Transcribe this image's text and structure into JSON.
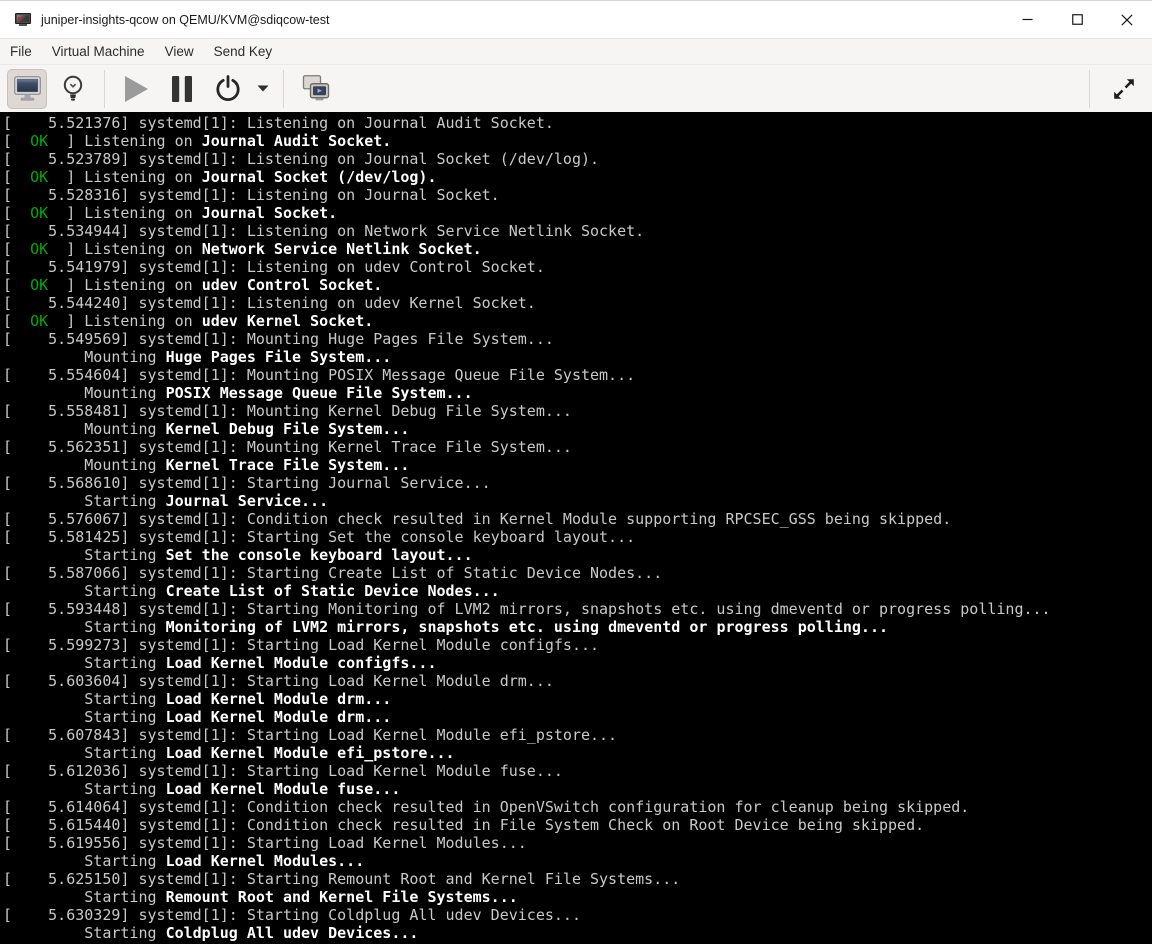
{
  "window": {
    "title": "juniper-insights-qcow on QEMU/KVM@sdiqcow-test",
    "controls": [
      "minimize",
      "maximize",
      "close"
    ]
  },
  "menu": {
    "items": [
      "File",
      "Virtual Machine",
      "View",
      "Send Key"
    ]
  },
  "toolbar": {
    "buttons": [
      "graphical-console",
      "virtual-hardware-details",
      "run",
      "pause",
      "shutdown",
      "shutdown-menu",
      "virtual-displays",
      "fullscreen"
    ],
    "active_button": "graphical-console",
    "disabled_button": "run"
  },
  "colors": {
    "console_bg": "#000000",
    "console_text": "#c9c9c9",
    "console_bold": "#ffffff",
    "ok_green": "#00ab00",
    "chrome_bg": "#f6f5f4",
    "titlebar_bg": "#ffffff"
  },
  "console": {
    "lines": [
      [
        {
          "s": "g",
          "t": "[    5.521376] systemd[1]: Listening on Journal Audit Socket."
        }
      ],
      [
        {
          "s": "g",
          "t": "[  "
        },
        {
          "s": "o",
          "t": "OK"
        },
        {
          "s": "g",
          "t": "  ] Listening on "
        },
        {
          "s": "w",
          "t": "Journal Audit Socket."
        }
      ],
      [
        {
          "s": "g",
          "t": "[    5.523789] systemd[1]: Listening on Journal Socket (/dev/log)."
        }
      ],
      [
        {
          "s": "g",
          "t": "[  "
        },
        {
          "s": "o",
          "t": "OK"
        },
        {
          "s": "g",
          "t": "  ] Listening on "
        },
        {
          "s": "w",
          "t": "Journal Socket (/dev/log)."
        }
      ],
      [
        {
          "s": "g",
          "t": "[    5.528316] systemd[1]: Listening on Journal Socket."
        }
      ],
      [
        {
          "s": "g",
          "t": "[  "
        },
        {
          "s": "o",
          "t": "OK"
        },
        {
          "s": "g",
          "t": "  ] Listening on "
        },
        {
          "s": "w",
          "t": "Journal Socket."
        }
      ],
      [
        {
          "s": "g",
          "t": "[    5.534944] systemd[1]: Listening on Network Service Netlink Socket."
        }
      ],
      [
        {
          "s": "g",
          "t": "[  "
        },
        {
          "s": "o",
          "t": "OK"
        },
        {
          "s": "g",
          "t": "  ] Listening on "
        },
        {
          "s": "w",
          "t": "Network Service Netlink Socket."
        }
      ],
      [
        {
          "s": "g",
          "t": "[    5.541979] systemd[1]: Listening on udev Control Socket."
        }
      ],
      [
        {
          "s": "g",
          "t": "[  "
        },
        {
          "s": "o",
          "t": "OK"
        },
        {
          "s": "g",
          "t": "  ] Listening on "
        },
        {
          "s": "w",
          "t": "udev Control Socket."
        }
      ],
      [
        {
          "s": "g",
          "t": "[    5.544240] systemd[1]: Listening on udev Kernel Socket."
        }
      ],
      [
        {
          "s": "g",
          "t": "[  "
        },
        {
          "s": "o",
          "t": "OK"
        },
        {
          "s": "g",
          "t": "  ] Listening on "
        },
        {
          "s": "w",
          "t": "udev Kernel Socket."
        }
      ],
      [
        {
          "s": "g",
          "t": "[    5.549569] systemd[1]: Mounting Huge Pages File System..."
        }
      ],
      [
        {
          "s": "g",
          "t": "         Mounting "
        },
        {
          "s": "w",
          "t": "Huge Pages File System..."
        }
      ],
      [
        {
          "s": "g",
          "t": "[    5.554604] systemd[1]: Mounting POSIX Message Queue File System..."
        }
      ],
      [
        {
          "s": "g",
          "t": "         Mounting "
        },
        {
          "s": "w",
          "t": "POSIX Message Queue File System..."
        }
      ],
      [
        {
          "s": "g",
          "t": "[    5.558481] systemd[1]: Mounting Kernel Debug File System..."
        }
      ],
      [
        {
          "s": "g",
          "t": "         Mounting "
        },
        {
          "s": "w",
          "t": "Kernel Debug File System..."
        }
      ],
      [
        {
          "s": "g",
          "t": "[    5.562351] systemd[1]: Mounting Kernel Trace File System..."
        }
      ],
      [
        {
          "s": "g",
          "t": "         Mounting "
        },
        {
          "s": "w",
          "t": "Kernel Trace File System..."
        }
      ],
      [
        {
          "s": "g",
          "t": "[    5.568610] systemd[1]: Starting Journal Service..."
        }
      ],
      [
        {
          "s": "g",
          "t": "         Starting "
        },
        {
          "s": "w",
          "t": "Journal Service..."
        }
      ],
      [
        {
          "s": "g",
          "t": "[    5.576067] systemd[1]: Condition check resulted in Kernel Module supporting RPCSEC_GSS being skipped."
        }
      ],
      [
        {
          "s": "g",
          "t": "[    5.581425] systemd[1]: Starting Set the console keyboard layout..."
        }
      ],
      [
        {
          "s": "g",
          "t": "         Starting "
        },
        {
          "s": "w",
          "t": "Set the console keyboard layout..."
        }
      ],
      [
        {
          "s": "g",
          "t": "[    5.587066] systemd[1]: Starting Create List of Static Device Nodes..."
        }
      ],
      [
        {
          "s": "g",
          "t": "         Starting "
        },
        {
          "s": "w",
          "t": "Create List of Static Device Nodes..."
        }
      ],
      [
        {
          "s": "g",
          "t": "[    5.593448] systemd[1]: Starting Monitoring of LVM2 mirrors, snapshots etc. using dmeventd or progress polling..."
        }
      ],
      [
        {
          "s": "g",
          "t": "         Starting "
        },
        {
          "s": "w",
          "t": "Monitoring of LVM2 mirrors, snapshots etc. using dmeventd or progress polling..."
        }
      ],
      [
        {
          "s": "g",
          "t": "[    5.599273] systemd[1]: Starting Load Kernel Module configfs..."
        }
      ],
      [
        {
          "s": "g",
          "t": "         Starting "
        },
        {
          "s": "w",
          "t": "Load Kernel Module configfs..."
        }
      ],
      [
        {
          "s": "g",
          "t": "[    5.603604] systemd[1]: Starting Load Kernel Module drm..."
        }
      ],
      [
        {
          "s": "g",
          "t": "         Starting "
        },
        {
          "s": "w",
          "t": "Load Kernel Module drm..."
        }
      ],
      [
        {
          "s": "g",
          "t": "         Starting "
        },
        {
          "s": "w",
          "t": "Load Kernel Module drm..."
        }
      ],
      [
        {
          "s": "g",
          "t": "[    5.607843] systemd[1]: Starting Load Kernel Module efi_pstore..."
        }
      ],
      [
        {
          "s": "g",
          "t": "         Starting "
        },
        {
          "s": "w",
          "t": "Load Kernel Module efi_pstore..."
        }
      ],
      [
        {
          "s": "g",
          "t": "[    5.612036] systemd[1]: Starting Load Kernel Module fuse..."
        }
      ],
      [
        {
          "s": "g",
          "t": "         Starting "
        },
        {
          "s": "w",
          "t": "Load Kernel Module fuse..."
        }
      ],
      [
        {
          "s": "g",
          "t": "[    5.614064] systemd[1]: Condition check resulted in OpenVSwitch configuration for cleanup being skipped."
        }
      ],
      [
        {
          "s": "g",
          "t": "[    5.615440] systemd[1]: Condition check resulted in File System Check on Root Device being skipped."
        }
      ],
      [
        {
          "s": "g",
          "t": "[    5.619556] systemd[1]: Starting Load Kernel Modules..."
        }
      ],
      [
        {
          "s": "g",
          "t": "         Starting "
        },
        {
          "s": "w",
          "t": "Load Kernel Modules..."
        }
      ],
      [
        {
          "s": "g",
          "t": "[    5.625150] systemd[1]: Starting Remount Root and Kernel File Systems..."
        }
      ],
      [
        {
          "s": "g",
          "t": "         Starting "
        },
        {
          "s": "w",
          "t": "Remount Root and Kernel File Systems..."
        }
      ],
      [
        {
          "s": "g",
          "t": "[    5.630329] systemd[1]: Starting Coldplug All udev Devices..."
        }
      ],
      [
        {
          "s": "g",
          "t": "         Starting "
        },
        {
          "s": "w",
          "t": "Coldplug All udev Devices..."
        }
      ]
    ]
  }
}
